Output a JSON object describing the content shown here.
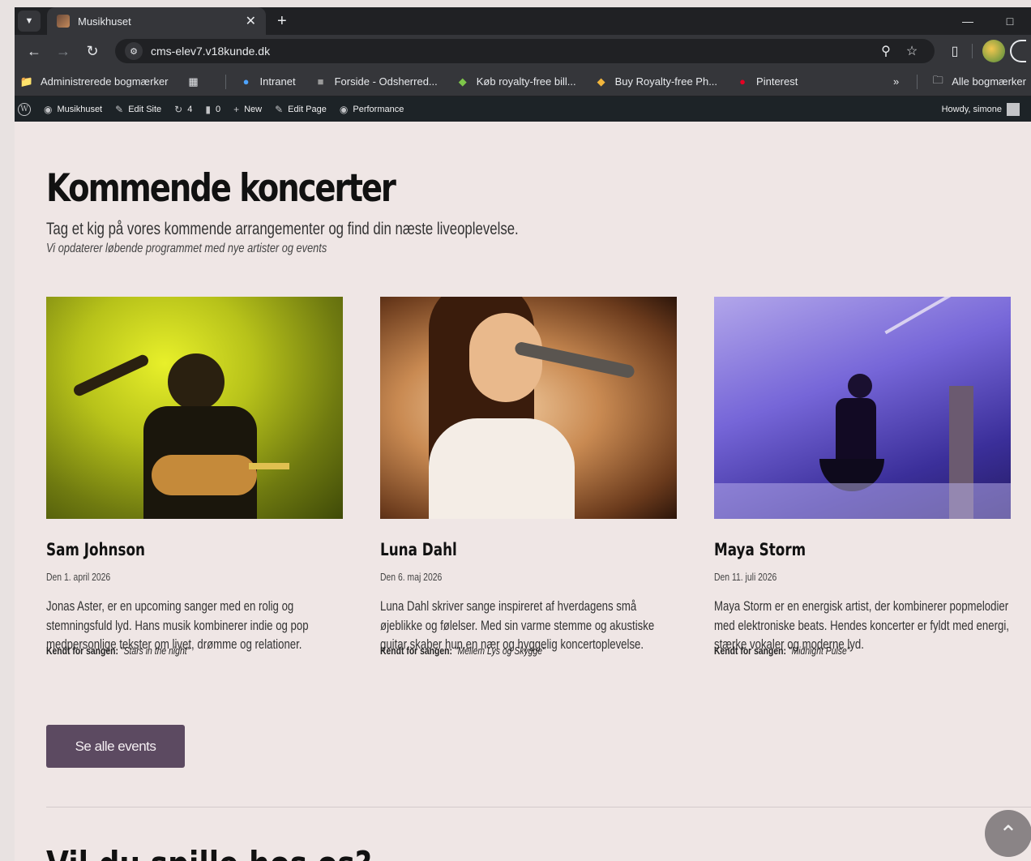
{
  "browser": {
    "tab_title": "Musikhuset",
    "url": "cms-elev7.v18kunde.dk",
    "bookmarks": [
      {
        "label": "Administrerede bogmærker"
      },
      {
        "label": "Intranet"
      },
      {
        "label": "Forside - Odsherred..."
      },
      {
        "label": "Køb royalty-free bill..."
      },
      {
        "label": "Buy Royalty-free Ph..."
      },
      {
        "label": "Pinterest"
      }
    ],
    "all_bookmarks": "Alle bogmærker",
    "more_bookmarks": "»"
  },
  "wpbar": {
    "site": "Musikhuset",
    "edit_site": "Edit Site",
    "updates": "4",
    "comments": "0",
    "new": "New",
    "edit_page": "Edit Page",
    "performance": "Performance",
    "howdy": "Howdy, simone"
  },
  "page": {
    "title": "Kommende koncerter",
    "lead": "Tag et kig på vores kommende arrangementer og find din næste liveoplevelse.",
    "sub": "Vi opdaterer løbende programmet med nye artister og events",
    "button": "Se alle events",
    "next_title": "Vil du spille hos os?"
  },
  "concerts": [
    {
      "name": "Sam Johnson",
      "date": "Den 1. april 2026",
      "desc": "Jonas Aster, er en upcoming sanger med en rolig og stemningsfuld lyd. Hans musik kombinerer indie og pop medpersonlige tekster om livet, drømme og relationer.",
      "song_label": "Kendt for sangen:",
      "song": "\"Stars in the night\""
    },
    {
      "name": "Luna Dahl",
      "date": "Den 6. maj 2026",
      "desc": "Luna Dahl skriver sange inspireret af hverdagens små øjeblikke og følelser. Med sin varme stemme og akustiske guitar skaber hun en nær og hyggelig koncertoplevelse.",
      "song_label": "Kendt for sangen:",
      "song": "\"Mellem Lys og Skygge\""
    },
    {
      "name": "Maya Storm",
      "date": "Den 11. juli 2026",
      "desc": "Maya Storm er en energisk artist, der kombinerer popmelodier med elektroniske beats. Hendes koncerter er fyldt med energi, stærke vokaler og moderne lyd.",
      "song_label": "Kendt for sangen:",
      "song": "\"Midnight Pulse\""
    }
  ]
}
